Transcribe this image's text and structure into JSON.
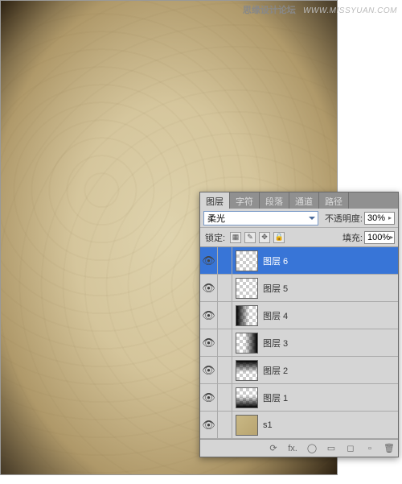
{
  "watermark": {
    "title": "思缘设计论坛",
    "url": "WWW.MISSYUAN.COM"
  },
  "panel": {
    "tabs": [
      "图层",
      "字符",
      "段落",
      "通道",
      "路径"
    ],
    "active_tab": 0,
    "blend_mode": "柔光",
    "opacity_label": "不透明度:",
    "opacity_value": "30%",
    "lock_label": "锁定:",
    "fill_label": "填充:",
    "fill_value": "100%",
    "layers": [
      {
        "name": "图层 6",
        "selected": true,
        "thumb": "checker"
      },
      {
        "name": "图层 5",
        "selected": false,
        "thumb": "checker"
      },
      {
        "name": "图层 4",
        "selected": false,
        "thumb": "checker grad-l"
      },
      {
        "name": "图层 3",
        "selected": false,
        "thumb": "checker grad-r"
      },
      {
        "name": "图层 2",
        "selected": false,
        "thumb": "checker grad-t"
      },
      {
        "name": "图层 1",
        "selected": false,
        "thumb": "checker grad-b"
      },
      {
        "name": "s1",
        "selected": false,
        "thumb": "tex"
      }
    ],
    "footer_icons": [
      "⟳",
      "fx.",
      "◯",
      "▭",
      "◻",
      "▫",
      "🗑"
    ]
  }
}
